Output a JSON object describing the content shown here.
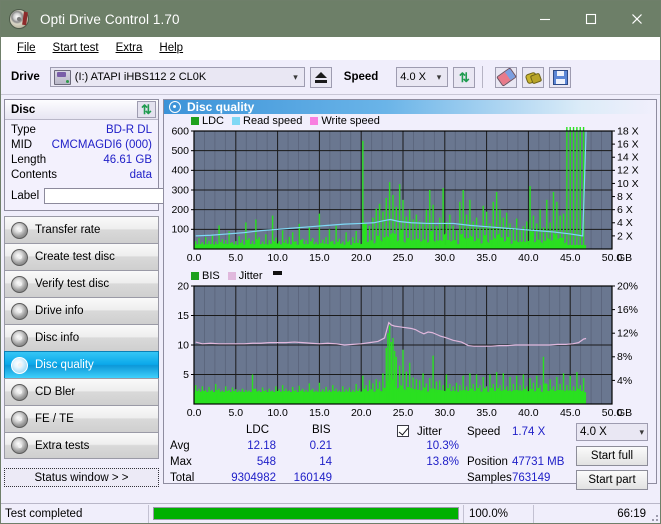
{
  "window": {
    "title": "Opti Drive Control 1.70",
    "icon": "disc-icon",
    "minimize": "–",
    "maximize": "□",
    "close": "✕"
  },
  "menu": {
    "items": [
      {
        "label": "File",
        "accel": "F"
      },
      {
        "label": "Start test",
        "accel": "S"
      },
      {
        "label": "Extra",
        "accel": "x"
      },
      {
        "label": "Help",
        "accel": "H"
      }
    ]
  },
  "toolbar": {
    "drive_label": "Drive",
    "drive_value": "(I:)   ATAPI iHBS112  2 CL0K",
    "eject_title": "eject-button",
    "speed_label": "Speed",
    "speed_value": "4.0 X",
    "buttons": [
      "refresh-icon",
      "eraser-icon",
      "plug-icon",
      "save-icon"
    ]
  },
  "disc": {
    "panel_title": "Disc",
    "refresh_icon": "refresh-icon",
    "rows": [
      {
        "key": "Type",
        "value": "BD-R DL"
      },
      {
        "key": "MID",
        "value": "CMCMAGDI6 (000)"
      },
      {
        "key": "Length",
        "value": "46.61 GB"
      },
      {
        "key": "Contents",
        "value": "data"
      }
    ],
    "label_key": "Label",
    "label_value": "",
    "label_placeholder": ""
  },
  "nav": {
    "items": [
      {
        "label": "Transfer rate",
        "active": false
      },
      {
        "label": "Create test disc",
        "active": false
      },
      {
        "label": "Verify test disc",
        "active": false
      },
      {
        "label": "Drive info",
        "active": false
      },
      {
        "label": "Disc info",
        "active": false
      },
      {
        "label": "Disc quality",
        "active": true
      },
      {
        "label": "CD Bler",
        "active": false
      },
      {
        "label": "FE / TE",
        "active": false
      },
      {
        "label": "Extra tests",
        "active": false
      }
    ],
    "status_window": "Status window > >"
  },
  "main": {
    "title": "Disc quality"
  },
  "stats": {
    "col_ldc": "LDC",
    "col_bis": "BIS",
    "row_avg": "Avg",
    "row_max": "Max",
    "row_total": "Total",
    "ldc_avg": "12.18",
    "ldc_max": "548",
    "ldc_total": "9304982",
    "bis_avg": "0.21",
    "bis_max": "14",
    "bis_total": "160149",
    "jitter_label": "Jitter",
    "jitter_checked": true,
    "jitter_avg": "10.3%",
    "jitter_max": "13.8%",
    "speed_key": "Speed",
    "speed_value": "1.74 X",
    "position_key": "Position",
    "position_value": "47731 MB",
    "samples_key": "Samples",
    "samples_value": "763149",
    "speed_select": "4.0 X",
    "start_full": "Start full",
    "start_part": "Start part"
  },
  "statusbar": {
    "message": "Test completed",
    "percent_label": "100.0%",
    "percent_value": 100,
    "elapsed": "66:19"
  },
  "colors": {
    "titlebar": "#6d7f68",
    "plot_bg": "#6a7790",
    "ldc_green": "#2ae020",
    "bis_green": "#2ae020",
    "read_speed": "#7fd8f5",
    "write_speed": "#f87fe0",
    "jitter": "#e0b8dd",
    "value_blue": "#2020c8",
    "progress_green": "#00b000",
    "accent_blue": "#0aa8ea"
  },
  "chart_data": [
    {
      "id": "quality-top",
      "type": "area",
      "title": "",
      "xlabel": "GB",
      "ylabel": "",
      "xlim": [
        0,
        50
      ],
      "ylim": [
        0,
        600
      ],
      "y2lim": [
        0,
        18
      ],
      "y2label": "X",
      "xticks": [
        "0.0",
        "5.0",
        "10.0",
        "15.0",
        "20.0",
        "25.0",
        "30.0",
        "35.0",
        "40.0",
        "45.0",
        "50.0"
      ],
      "yticks": [
        100,
        200,
        300,
        400,
        500,
        600
      ],
      "y2ticks": [
        "2 X",
        "4 X",
        "6 X",
        "8 X",
        "10 X",
        "12 X",
        "14 X",
        "16 X",
        "18 X"
      ],
      "legend": [
        {
          "name": "LDC",
          "color": "#1ea01e"
        },
        {
          "name": "Read speed",
          "color": "#7fd8f5"
        },
        {
          "name": "Write speed",
          "color": "#f87fe0"
        }
      ],
      "legend_position": "top-left",
      "grid": true,
      "data_end_x": 46.9,
      "series": [
        {
          "name": "LDC",
          "kind": "spikes",
          "color": "#2ae020",
          "baseline": 20,
          "x": [
            0.2,
            0.6,
            1.0,
            1.4,
            1.8,
            2.2,
            2.6,
            3.0,
            3.4,
            3.8,
            4.2,
            4.6,
            5.0,
            5.4,
            5.8,
            6.2,
            6.6,
            7.0,
            7.4,
            7.8,
            8.2,
            8.6,
            9.0,
            9.4,
            9.8,
            10.2,
            10.6,
            11.0,
            11.4,
            11.8,
            12.2,
            12.6,
            13.0,
            13.4,
            13.8,
            14.2,
            14.6,
            15.0,
            15.4,
            15.8,
            16.2,
            16.6,
            17.0,
            17.4,
            17.8,
            18.2,
            18.6,
            19.0,
            19.4,
            19.8,
            20.2,
            20.6,
            21.0,
            21.4,
            21.8,
            22.2,
            22.6,
            23.0,
            23.4,
            23.8,
            24.2,
            24.6,
            25.0,
            25.4,
            25.8,
            26.2,
            26.6,
            27.0,
            27.4,
            27.8,
            28.2,
            28.6,
            29.0,
            29.4,
            29.8,
            30.2,
            30.6,
            31.0,
            31.4,
            31.8,
            32.2,
            32.6,
            33.0,
            33.4,
            33.8,
            34.2,
            34.6,
            35.0,
            35.4,
            35.8,
            36.2,
            36.6,
            37.0,
            37.4,
            37.8,
            38.2,
            38.6,
            39.0,
            39.4,
            39.8,
            40.2,
            40.6,
            41.0,
            41.4,
            41.8,
            42.2,
            42.6,
            43.0,
            43.4,
            43.8,
            44.2,
            44.6,
            45.0,
            45.4,
            45.8,
            46.2,
            46.6
          ],
          "y": [
            40,
            55,
            35,
            60,
            42,
            70,
            38,
            120,
            50,
            45,
            90,
            35,
            40,
            65,
            48,
            135,
            55,
            42,
            150,
            60,
            38,
            75,
            45,
            170,
            58,
            40,
            95,
            48,
            62,
            85,
            40,
            128,
            52,
            44,
            110,
            55,
            35,
            180,
            48,
            60,
            100,
            42,
            118,
            52,
            38,
            85,
            44,
            60,
            92,
            48,
            550,
            132,
            118,
            160,
            205,
            230,
            190,
            260,
            340,
            275,
            215,
            330,
            250,
            165,
            200,
            150,
            175,
            142,
            135,
            200,
            300,
            225,
            118,
            160,
            310,
            138,
            175,
            120,
            95,
            240,
            300,
            175,
            250,
            140,
            160,
            110,
            220,
            190,
            130,
            240,
            290,
            200,
            160,
            185,
            130,
            110,
            155,
            95,
            115,
            140,
            320,
            170,
            130,
            200,
            110,
            250,
            135,
            290,
            240,
            170,
            180
          ]
        },
        {
          "name": "Read speed",
          "kind": "line",
          "color": "#7fd8f5",
          "axis": "right",
          "x": [
            0.2,
            2,
            4,
            6,
            8,
            10,
            12,
            14,
            16,
            18,
            20,
            21.5,
            23,
            23.5,
            24.5,
            26,
            28,
            29.5,
            31,
            33,
            35,
            37,
            39,
            41,
            43,
            45,
            46.5,
            46.9
          ],
          "y": [
            2.0,
            2.1,
            2.3,
            2.5,
            2.8,
            3.0,
            3.2,
            3.4,
            3.6,
            3.8,
            3.9,
            4.0,
            4.4,
            4.5,
            4.2,
            4.0,
            3.9,
            3.9,
            3.9,
            3.6,
            3.4,
            3.2,
            3.0,
            2.8,
            2.6,
            2.3,
            2.0,
            18.0
          ]
        }
      ]
    },
    {
      "id": "quality-bottom",
      "type": "area",
      "title": "",
      "xlabel": "GB",
      "ylabel": "",
      "xlim": [
        0,
        50
      ],
      "ylim": [
        0,
        20
      ],
      "y2lim": [
        0,
        20
      ],
      "y2label": "%",
      "xticks": [
        "0.0",
        "5.0",
        "10.0",
        "15.0",
        "20.0",
        "25.0",
        "30.0",
        "35.0",
        "40.0",
        "45.0",
        "50.0"
      ],
      "yticks": [
        5,
        10,
        15,
        20
      ],
      "y2ticks": [
        "4%",
        "8%",
        "12%",
        "16%",
        "20%"
      ],
      "legend": [
        {
          "name": "BIS",
          "color": "#1ea01e"
        },
        {
          "name": "Jitter",
          "color": "#e0b8dd"
        }
      ],
      "legend_position": "top-left",
      "grid": true,
      "data_end_x": 46.9,
      "series": [
        {
          "name": "BIS",
          "kind": "spikes",
          "color": "#2ae020",
          "baseline": 2.0,
          "x": [
            0.2,
            0.6,
            1.0,
            1.4,
            1.8,
            2.2,
            2.6,
            3.0,
            3.4,
            3.8,
            4.2,
            4.6,
            5.0,
            5.4,
            5.8,
            6.2,
            6.6,
            7.0,
            7.4,
            7.8,
            8.2,
            8.6,
            9.0,
            9.4,
            9.8,
            10.2,
            10.6,
            11.0,
            11.4,
            11.8,
            12.2,
            12.6,
            13.0,
            13.4,
            13.8,
            14.2,
            14.6,
            15.0,
            15.4,
            15.8,
            16.2,
            16.6,
            17.0,
            17.4,
            17.8,
            18.2,
            18.6,
            19.0,
            19.4,
            19.8,
            20.2,
            20.6,
            21.0,
            21.4,
            21.8,
            22.2,
            22.6,
            23.0,
            23.2,
            23.4,
            23.6,
            23.8,
            24.0,
            24.2,
            24.6,
            25.0,
            25.4,
            25.8,
            26.2,
            26.6,
            27.0,
            27.4,
            27.8,
            28.2,
            28.6,
            29.0,
            29.4,
            29.8,
            30.2,
            30.6,
            31.0,
            31.4,
            31.8,
            32.2,
            32.6,
            33.0,
            33.4,
            33.8,
            34.2,
            34.6,
            35.0,
            35.4,
            35.8,
            36.2,
            36.6,
            37.0,
            37.4,
            37.8,
            38.2,
            38.6,
            39.0,
            39.4,
            39.8,
            40.2,
            40.6,
            41.0,
            41.4,
            41.8,
            42.2,
            42.6,
            43.0,
            43.4,
            43.8,
            44.2,
            44.6,
            45.0,
            45.4,
            45.8,
            46.2,
            46.6
          ],
          "y": [
            3.2,
            2.6,
            3.0,
            2.4,
            2.9,
            2.4,
            3.4,
            2.6,
            2.3,
            3.0,
            2.4,
            2.8,
            2.5,
            2.3,
            2.6,
            2.4,
            2.3,
            5.0,
            2.6,
            2.3,
            2.8,
            2.4,
            2.6,
            2.3,
            3.0,
            2.5,
            3.2,
            2.6,
            2.3,
            2.9,
            2.4,
            3.1,
            2.6,
            2.4,
            3.5,
            2.6,
            2.3,
            3.6,
            2.5,
            2.9,
            2.4,
            3.2,
            2.6,
            2.3,
            3.0,
            2.5,
            2.8,
            2.4,
            3.4,
            2.6,
            4.8,
            3.2,
            4.0,
            3.5,
            4.2,
            3.8,
            5.2,
            9.5,
            12.0,
            13.3,
            10.5,
            11.2,
            9.0,
            8.0,
            6.5,
            9.2,
            5.5,
            7.0,
            4.5,
            4.2,
            4.0,
            5.2,
            3.5,
            4.4,
            8.2,
            3.8,
            4.0,
            3.2,
            5.0,
            3.4,
            3.0,
            3.6,
            3.2,
            4.8,
            3.0,
            5.2,
            3.4,
            5.0,
            3.2,
            4.6,
            3.0,
            5.0,
            3.4,
            5.4,
            3.2,
            5.2,
            3.0,
            4.6,
            3.4,
            4.8,
            3.2,
            5.0,
            3.0,
            4.4,
            3.6,
            4.8,
            3.2,
            8.0,
            3.4,
            4.2,
            3.0,
            4.6,
            3.4,
            5.2,
            3.2,
            4.8,
            3.0,
            5.4,
            3.2,
            4.4
          ]
        },
        {
          "name": "Jitter",
          "kind": "line",
          "color": "#e0b8dd",
          "axis": "right",
          "x": [
            0.2,
            1,
            2,
            3,
            4,
            5,
            6,
            7,
            8,
            9,
            10,
            11,
            12,
            13,
            14,
            15,
            16,
            17,
            18,
            19,
            20,
            21,
            22,
            22.8,
            23.3,
            23.6,
            24,
            24.5,
            25,
            25.5,
            26,
            26.5,
            27,
            27.5,
            28,
            28.5,
            29,
            29.5,
            30,
            31,
            32,
            32.8,
            33.5,
            34.5,
            35.5,
            36.5,
            37.5,
            38.5,
            39.5,
            40.5,
            41.5,
            42.5,
            43.5,
            44.5,
            45.3,
            46,
            46.6,
            46.9
          ],
          "y": [
            10.5,
            10.2,
            10.3,
            10.2,
            10.2,
            10.2,
            10.2,
            10.3,
            10.3,
            10.4,
            10.4,
            10.4,
            10.5,
            10.4,
            10.3,
            10.2,
            10.3,
            10.2,
            10.0,
            10.1,
            10.2,
            10.4,
            10.6,
            11.2,
            13.8,
            13.4,
            13.2,
            13.1,
            13.0,
            12.9,
            12.8,
            12.6,
            12.2,
            11.9,
            12.2,
            12.1,
            11.8,
            11.5,
            11.3,
            10.8,
            10.5,
            9.9,
            9.8,
            9.8,
            9.8,
            9.9,
            9.9,
            10.0,
            10.0,
            10.0,
            10.0,
            10.0,
            10.1,
            10.1,
            10.2,
            10.4,
            11.0,
            11.1
          ]
        }
      ]
    }
  ]
}
